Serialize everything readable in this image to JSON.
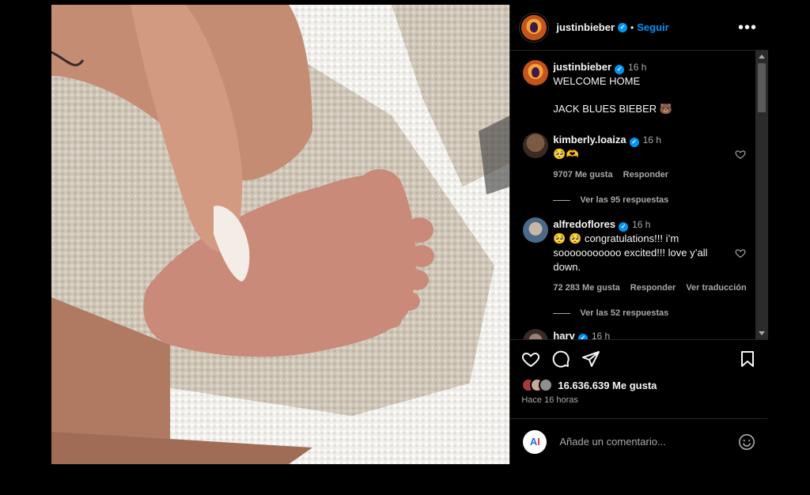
{
  "post": {
    "author": "justinbieber",
    "follow_label": "Seguir",
    "separator": "•",
    "more_icon": "more-horizontal-icon"
  },
  "caption": {
    "username": "justinbieber",
    "time": "16 h",
    "line1": "WELCOME HOME",
    "line2": "JACK BLUES BIEBER 🐻"
  },
  "comments": [
    {
      "username": "kimberly.loaiza",
      "time": "16 h",
      "text": "🥺🫶",
      "likes": "9707 Me gusta",
      "reply": "Responder",
      "view_replies": "Ver las 95 respuestas"
    },
    {
      "username": "alfredoflores",
      "time": "16 h",
      "text": "🥺 🥺 congratulations!!! i’m sooooooooooo excited!!! love y’all down.",
      "likes": "72 283 Me gusta",
      "reply": "Responder",
      "translate": "Ver traducción",
      "view_replies": "Ver las 52 respuestas"
    },
    {
      "username": "harv",
      "time": "16 h"
    }
  ],
  "stats": {
    "likes": "16.636.639 Me gusta",
    "ago": "Hace 16 horas"
  },
  "composer": {
    "placeholder": "Añade un comentario..."
  },
  "colors": {
    "accent": "#0095f6",
    "background": "#000000",
    "muted": "#a8a8a8"
  }
}
